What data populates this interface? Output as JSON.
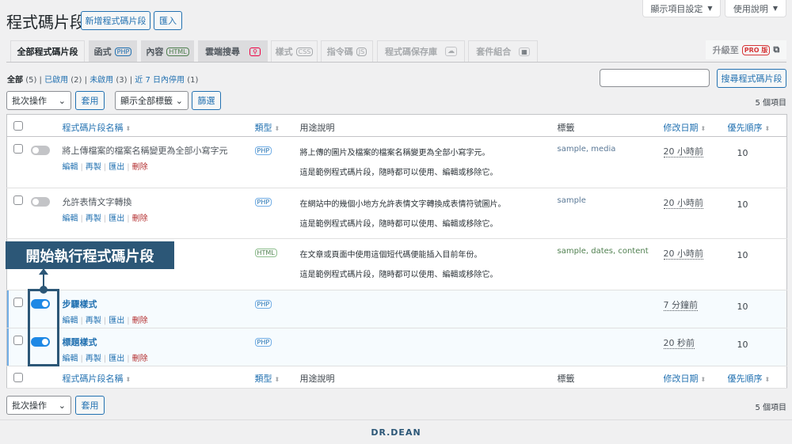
{
  "header": {
    "title": "程式碼片段",
    "add_new": "新增程式碼片段",
    "import": "匯入",
    "screen_options": "顯示項目設定",
    "help": "使用說明"
  },
  "tabs": [
    {
      "label": "全部程式碼片段"
    },
    {
      "label": "函式",
      "badge": "PHP"
    },
    {
      "label": "內容",
      "badge": "HTML"
    },
    {
      "label": "雲端搜尋"
    },
    {
      "label": "樣式",
      "badge": "CSS"
    },
    {
      "label": "指令碼",
      "badge": "JS"
    },
    {
      "label": "程式碼保存庫"
    },
    {
      "label": "套件組合"
    }
  ],
  "upgrade": {
    "label": "升級至",
    "pro": "PRO 版"
  },
  "filters": {
    "all": "全部",
    "all_count": "(5)",
    "active": "已啟用",
    "active_count": "(2)",
    "inactive": "未啟用",
    "inactive_count": "(3)",
    "recent": "近 7 日內停用",
    "recent_count": "(1)"
  },
  "search": {
    "value": "",
    "button": "搜尋程式碼片段"
  },
  "bulk": {
    "select": "批次操作",
    "apply": "套用",
    "tags_select": "顯示全部標籤",
    "filter": "篩選"
  },
  "item_count": "5 個項目",
  "columns": {
    "name": "程式碼片段名稱",
    "type": "類型",
    "desc": "用途說明",
    "tags": "標籤",
    "modified": "修改日期",
    "priority": "優先順序"
  },
  "row_actions": {
    "edit": "編輯",
    "clone": "再製",
    "export": "匯出",
    "delete": "刪除"
  },
  "rows": [
    {
      "name": "將上傳檔案的檔案名稱變更為全部小寫字元",
      "type": "PHP",
      "desc": "將上傳的圖片及檔案的檔案名稱變更為全部小寫字元。",
      "desc2": "這是範例程式碼片段，隨時都可以使用、編輯或移除它。",
      "tags": "sample, media",
      "modified": "20 小時前",
      "priority": "10",
      "active": false
    },
    {
      "name": "允許表情文字轉換",
      "type": "PHP",
      "desc": "在網站中的幾個小地方允許表情文字轉換成表情符號圖片。",
      "desc2": "這是範例程式碼片段，隨時都可以使用、編輯或移除它。",
      "tags": "sample",
      "modified": "20 小時前",
      "priority": "10",
      "active": false
    },
    {
      "name": "",
      "type": "HTML",
      "desc": "在文章或頁面中使用這個短代碼便能插入目前年份。",
      "desc2": "這是範例程式碼片段，隨時都可以使用、編輯或移除它。",
      "tags": "sample, dates, content",
      "modified": "20 小時前",
      "priority": "10",
      "active": false
    },
    {
      "name": "步驟樣式",
      "type": "PHP",
      "desc": "",
      "desc2": "",
      "tags": "",
      "modified": "7 分鐘前",
      "priority": "10",
      "active": true
    },
    {
      "name": "標題樣式",
      "type": "PHP",
      "desc": "",
      "desc2": "",
      "tags": "",
      "modified": "20 秒前",
      "priority": "10",
      "active": true
    }
  ],
  "annotation": "開始執行程式碼片段",
  "footer": {
    "logo": "DR.DEAN"
  }
}
